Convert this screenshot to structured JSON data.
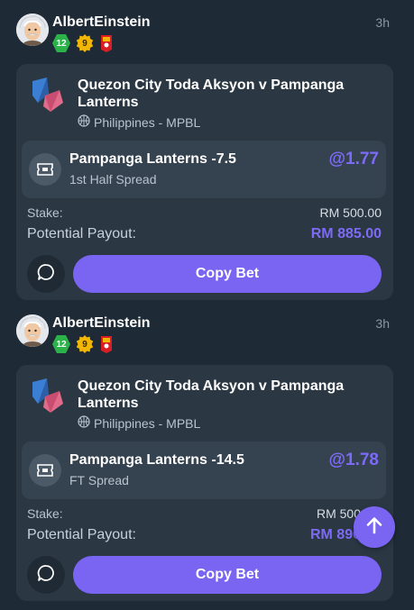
{
  "posts": [
    {
      "username": "AlbertEinstein",
      "time": "3h",
      "badges": [
        "12",
        "9"
      ],
      "match": "Quezon City Toda Aksyon v Pampanga Lanterns",
      "league": "Philippines - MPBL",
      "selection": "Pampanga Lanterns -7.5",
      "market": "1st Half Spread",
      "odds": "@1.77",
      "stake_label": "Stake:",
      "stake": "RM 500.00",
      "payout_label": "Potential Payout:",
      "payout": "RM 885.00",
      "copy_label": "Copy Bet"
    },
    {
      "username": "AlbertEinstein",
      "time": "3h",
      "badges": [
        "12",
        "9"
      ],
      "match": "Quezon City Toda Aksyon v Pampanga Lanterns",
      "league": "Philippines - MPBL",
      "selection": "Pampanga Lanterns -14.5",
      "market": "FT Spread",
      "odds": "@1.78",
      "stake_label": "Stake:",
      "stake": "RM 500",
      "payout_label": "Potential Payout:",
      "payout": "RM 890",
      "copy_label": "Copy Bet"
    }
  ],
  "colors": {
    "background": "#1e2a36",
    "card": "#2b3844",
    "accent": "#7a64f2",
    "odds": "#7d6bf5"
  },
  "icons": {
    "scroll_top": "arrow-up-icon",
    "chat": "chat-bubble-icon",
    "ticket": "ticket-icon",
    "sport": "basketball-icon"
  }
}
